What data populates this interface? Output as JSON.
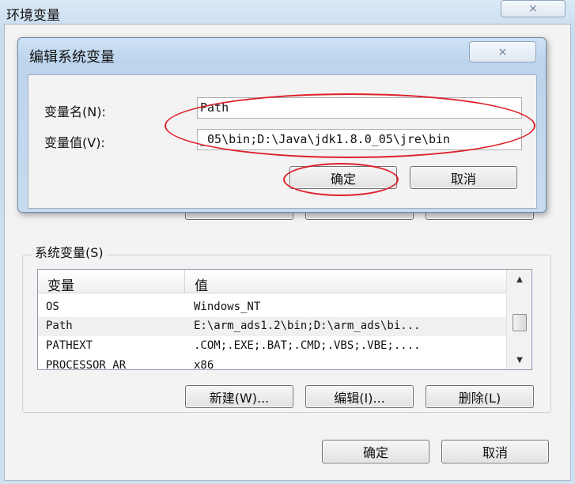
{
  "outer_dialog": {
    "title": "环境变量",
    "close_icon": "×",
    "system_vars_label": "系统变量(S)",
    "list_header": {
      "col_var": "变量",
      "col_val": "值"
    },
    "rows": [
      {
        "name": "OS",
        "value": "Windows_NT"
      },
      {
        "name": "Path",
        "value": "E:\\arm_ads1.2\\bin;D:\\arm_ads\\bi..."
      },
      {
        "name": "PATHEXT",
        "value": ".COM;.EXE;.BAT;.CMD;.VBS;.VBE;...."
      },
      {
        "name": "PROCESSOR_AR",
        "value": "x86"
      }
    ],
    "buttons": {
      "new": "新建(W)...",
      "edit": "编辑(I)...",
      "delete": "删除(L)"
    },
    "ok": "确定",
    "cancel": "取消"
  },
  "inner_dialog": {
    "title": "编辑系统变量",
    "close_icon": "×",
    "name_label": "变量名(N):",
    "name_value": "Path",
    "value_label": "变量值(V):",
    "value_value": "_05\\bin;D:\\Java\\jdk1.8.0_05\\jre\\bin",
    "ok": "确定",
    "cancel": "取消"
  },
  "colors": {
    "annotation": "#e0202a",
    "title_bar": "#c7dbef"
  },
  "icons": {
    "close": "close-icon",
    "scroll_up": "scroll-up-arrow-icon",
    "scroll_down": "scroll-down-arrow-icon"
  }
}
